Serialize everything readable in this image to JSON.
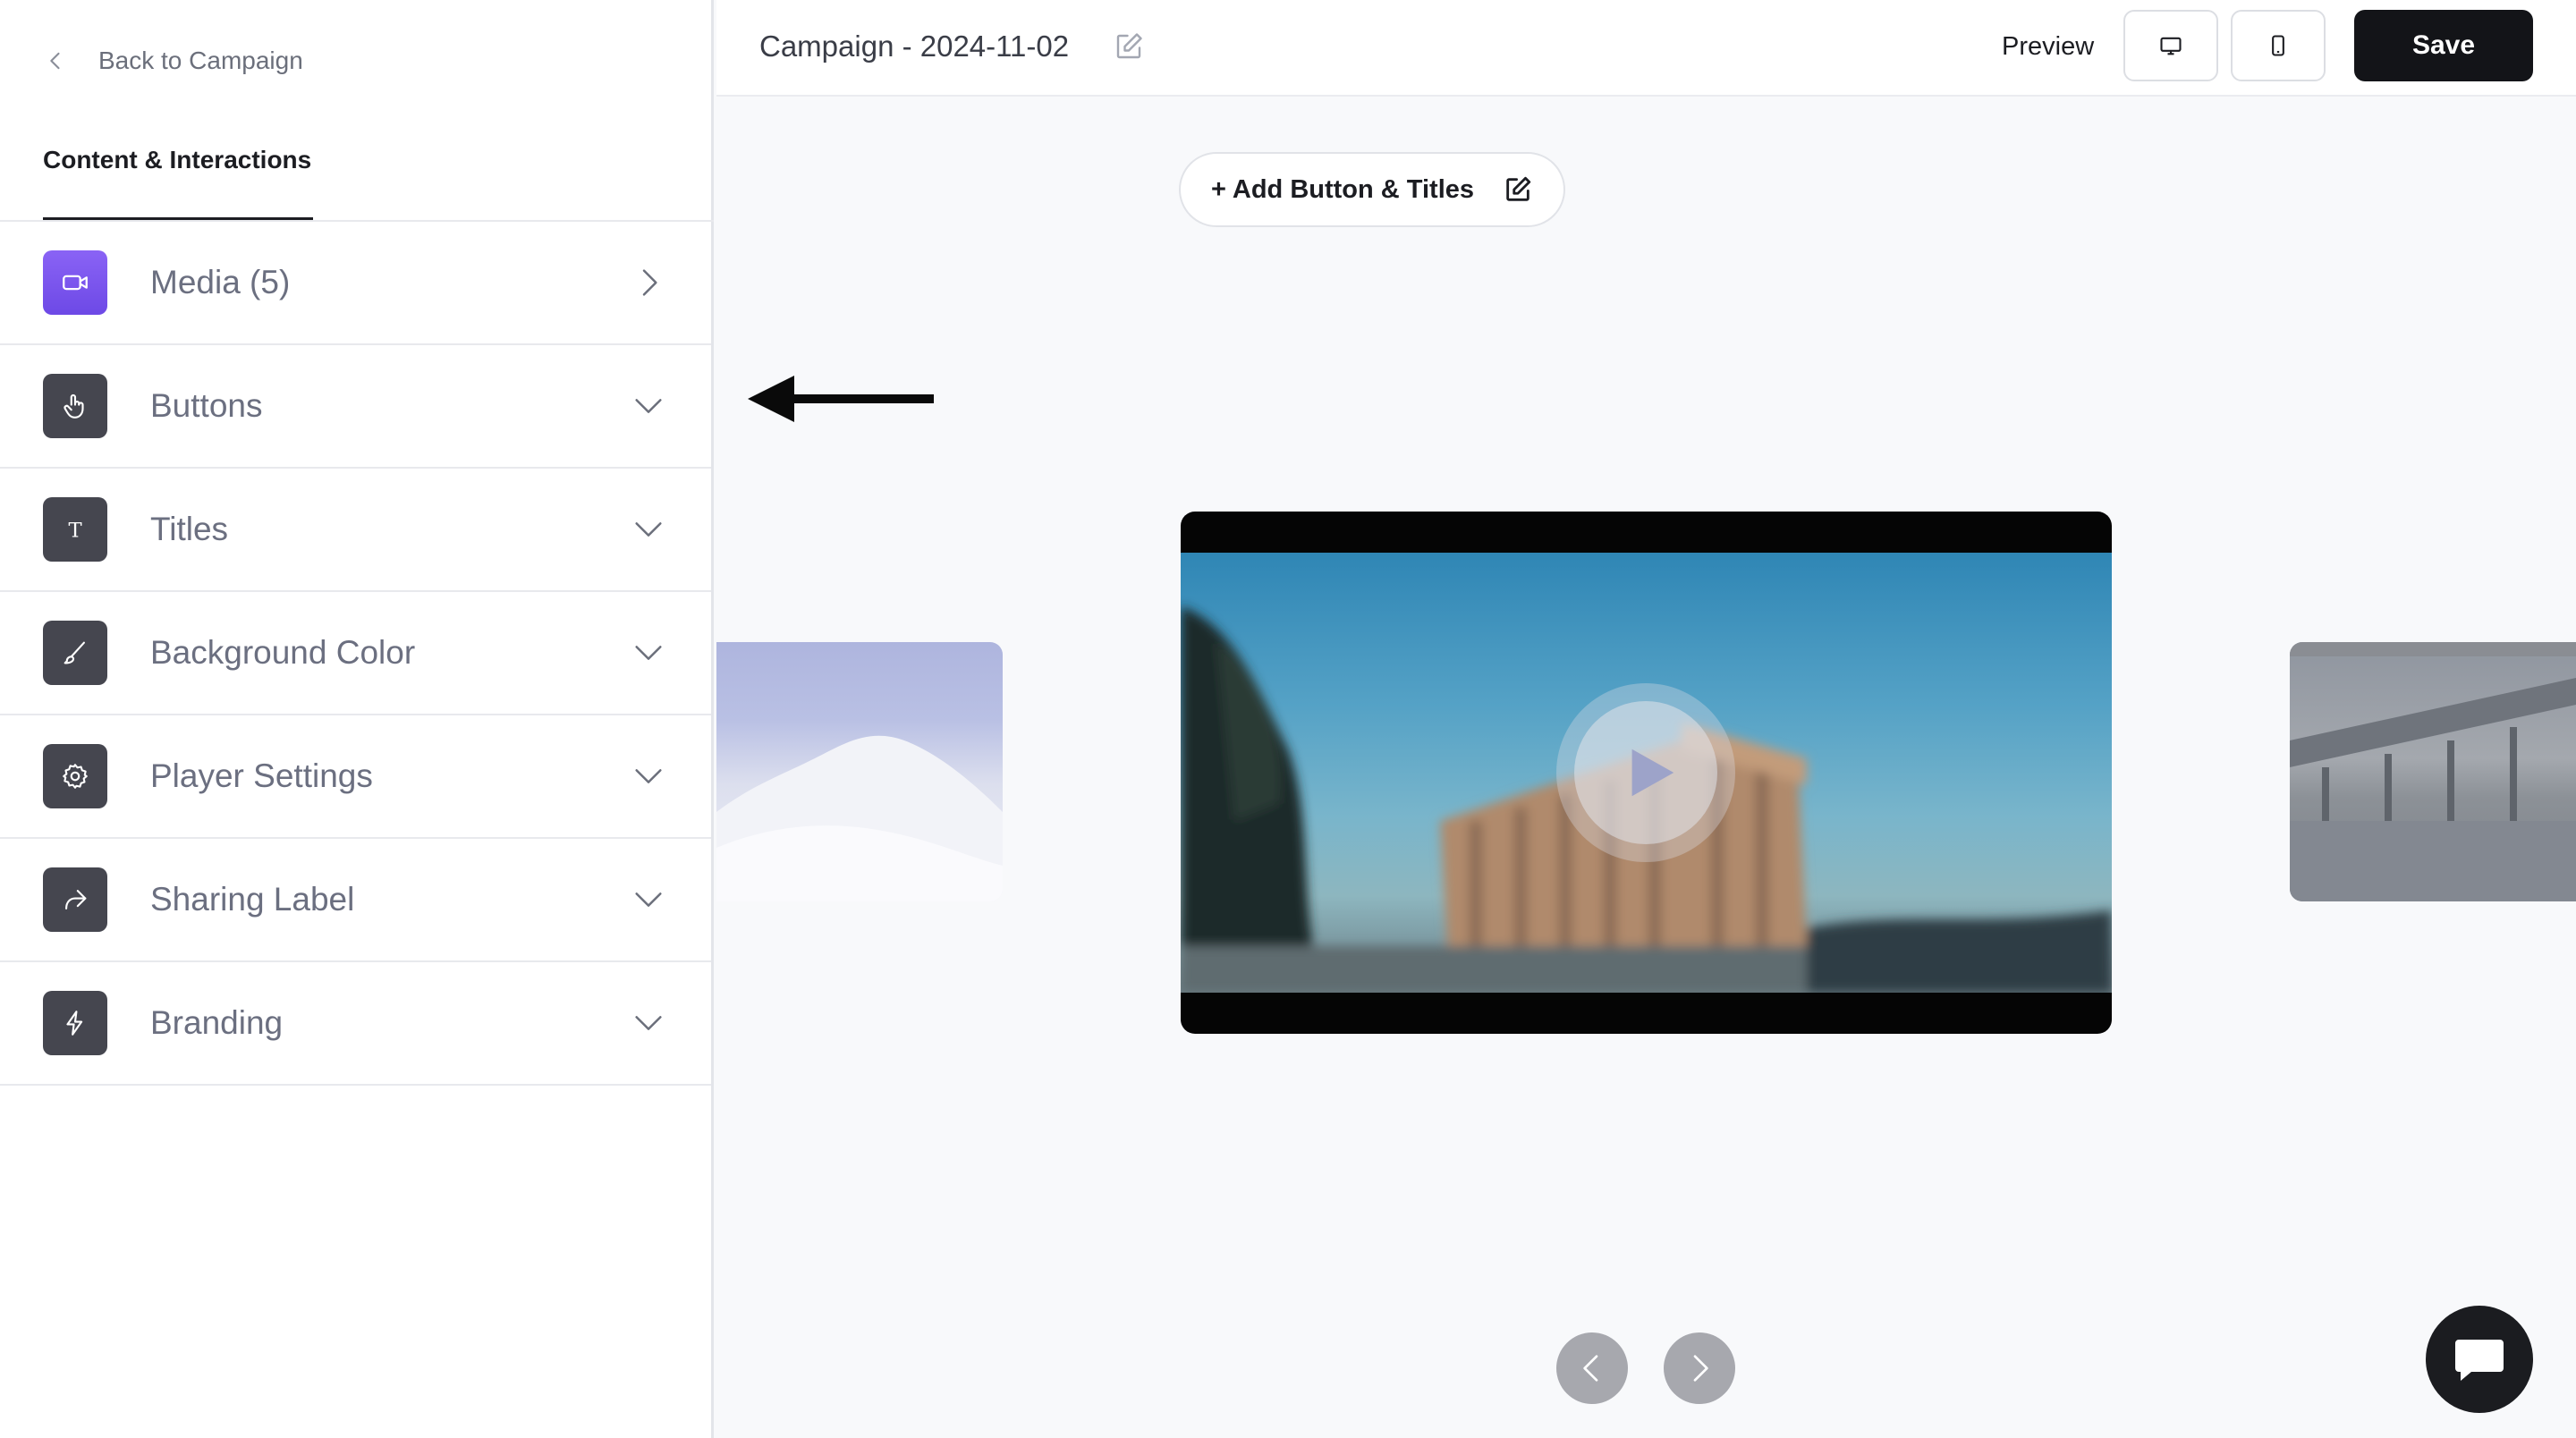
{
  "sidebar": {
    "back_label": "Back to Campaign",
    "tab_label": "Content & Interactions",
    "items": [
      {
        "label": "Media (5)",
        "icon": "video-camera-icon",
        "indicator": "chevron-right-icon"
      },
      {
        "label": "Buttons",
        "icon": "hand-pointer-icon",
        "indicator": "chevron-down-icon"
      },
      {
        "label": "Titles",
        "icon": "text-t-icon",
        "indicator": "chevron-down-icon"
      },
      {
        "label": "Background Color",
        "icon": "brush-icon",
        "indicator": "chevron-down-icon"
      },
      {
        "label": "Player Settings",
        "icon": "gear-icon",
        "indicator": "chevron-down-icon"
      },
      {
        "label": "Sharing Label",
        "icon": "share-arrow-icon",
        "indicator": "chevron-down-icon"
      },
      {
        "label": "Branding",
        "icon": "lightning-icon",
        "indicator": "chevron-down-icon"
      }
    ]
  },
  "header": {
    "title": "Campaign - 2024-11-02",
    "preview_label": "Preview",
    "save_label": "Save",
    "device_icons": [
      "desktop-icon",
      "mobile-icon"
    ]
  },
  "canvas": {
    "add_button_label": "+ Add Button & Titles"
  },
  "colors": {
    "accent_media": "#7b55ee",
    "icon_tile": "#45464f",
    "save_bg": "#131418",
    "canvas_bg": "#f8f9fb"
  }
}
